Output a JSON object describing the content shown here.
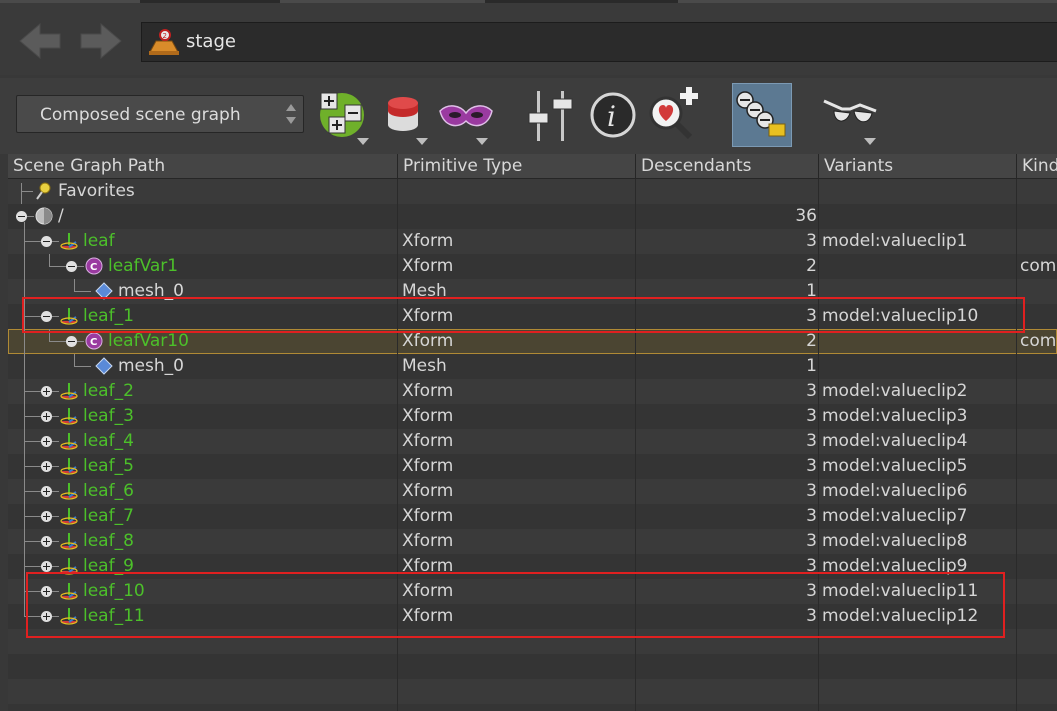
{
  "nav": {
    "path_label": "stage"
  },
  "toolbar": {
    "view_mode_label": "Composed scene graph",
    "icons": [
      "expand-collapse-icon",
      "layers-icon",
      "mask-icon",
      "sliders-icon",
      "info-icon",
      "inspect-zoom-icon",
      "snapshot-icon",
      "glasses-icon"
    ]
  },
  "table": {
    "headers": [
      "Scene Graph Path",
      "Primitive Type",
      "Descendants",
      "Variants",
      "Kind"
    ],
    "rows": [
      {
        "name": "Favorites",
        "type": "",
        "descendants": "",
        "variants": "",
        "kind": "",
        "depth": 0,
        "expander": "none",
        "icon": "favorites-pin-icon",
        "color": "white"
      },
      {
        "name": "/",
        "type": "",
        "descendants": "36",
        "variants": "",
        "kind": "",
        "depth": 0,
        "expander": "minus",
        "icon": "root-sphere-icon",
        "color": "white"
      },
      {
        "name": "leaf",
        "type": "Xform",
        "descendants": "3",
        "variants": "model:valueclip1",
        "kind": "",
        "depth": 1,
        "expander": "minus",
        "icon": "xform-icon",
        "color": "green"
      },
      {
        "name": "leafVar1",
        "type": "Xform",
        "descendants": "2",
        "variants": "",
        "kind": "com",
        "depth": 2,
        "expander": "minus",
        "icon": "component-c-icon",
        "color": "green"
      },
      {
        "name": "mesh_0",
        "type": "Mesh",
        "descendants": "1",
        "variants": "",
        "kind": "",
        "depth": 3,
        "expander": "none",
        "icon": "mesh-diamond-icon",
        "color": "white"
      },
      {
        "name": "leaf_1",
        "type": "Xform",
        "descendants": "3",
        "variants": "model:valueclip10",
        "kind": "",
        "depth": 1,
        "expander": "minus",
        "icon": "xform-icon",
        "color": "green"
      },
      {
        "name": "leafVar10",
        "type": "Xform",
        "descendants": "2",
        "variants": "",
        "kind": "com",
        "depth": 2,
        "expander": "minus",
        "icon": "component-c-icon",
        "color": "green",
        "selected": true
      },
      {
        "name": "mesh_0",
        "type": "Mesh",
        "descendants": "1",
        "variants": "",
        "kind": "",
        "depth": 3,
        "expander": "none",
        "icon": "mesh-diamond-icon",
        "color": "white"
      },
      {
        "name": "leaf_2",
        "type": "Xform",
        "descendants": "3",
        "variants": "model:valueclip2",
        "kind": "",
        "depth": 1,
        "expander": "plus",
        "icon": "xform-icon",
        "color": "green"
      },
      {
        "name": "leaf_3",
        "type": "Xform",
        "descendants": "3",
        "variants": "model:valueclip3",
        "kind": "",
        "depth": 1,
        "expander": "plus",
        "icon": "xform-icon",
        "color": "green"
      },
      {
        "name": "leaf_4",
        "type": "Xform",
        "descendants": "3",
        "variants": "model:valueclip4",
        "kind": "",
        "depth": 1,
        "expander": "plus",
        "icon": "xform-icon",
        "color": "green"
      },
      {
        "name": "leaf_5",
        "type": "Xform",
        "descendants": "3",
        "variants": "model:valueclip5",
        "kind": "",
        "depth": 1,
        "expander": "plus",
        "icon": "xform-icon",
        "color": "green"
      },
      {
        "name": "leaf_6",
        "type": "Xform",
        "descendants": "3",
        "variants": "model:valueclip6",
        "kind": "",
        "depth": 1,
        "expander": "plus",
        "icon": "xform-icon",
        "color": "green"
      },
      {
        "name": "leaf_7",
        "type": "Xform",
        "descendants": "3",
        "variants": "model:valueclip7",
        "kind": "",
        "depth": 1,
        "expander": "plus",
        "icon": "xform-icon",
        "color": "green"
      },
      {
        "name": "leaf_8",
        "type": "Xform",
        "descendants": "3",
        "variants": "model:valueclip8",
        "kind": "",
        "depth": 1,
        "expander": "plus",
        "icon": "xform-icon",
        "color": "green"
      },
      {
        "name": "leaf_9",
        "type": "Xform",
        "descendants": "3",
        "variants": "model:valueclip9",
        "kind": "",
        "depth": 1,
        "expander": "plus",
        "icon": "xform-icon",
        "color": "green"
      },
      {
        "name": "leaf_10",
        "type": "Xform",
        "descendants": "3",
        "variants": "model:valueclip11",
        "kind": "",
        "depth": 1,
        "expander": "plus",
        "icon": "xform-icon",
        "color": "green"
      },
      {
        "name": "leaf_11",
        "type": "Xform",
        "descendants": "3",
        "variants": "model:valueclip12",
        "kind": "",
        "depth": 1,
        "expander": "plus",
        "icon": "xform-icon",
        "color": "green"
      }
    ]
  },
  "colors": {
    "prim_name_green": "#4cc02a",
    "selection_outline": "#b08a35",
    "annotation_red": "#e02020"
  }
}
